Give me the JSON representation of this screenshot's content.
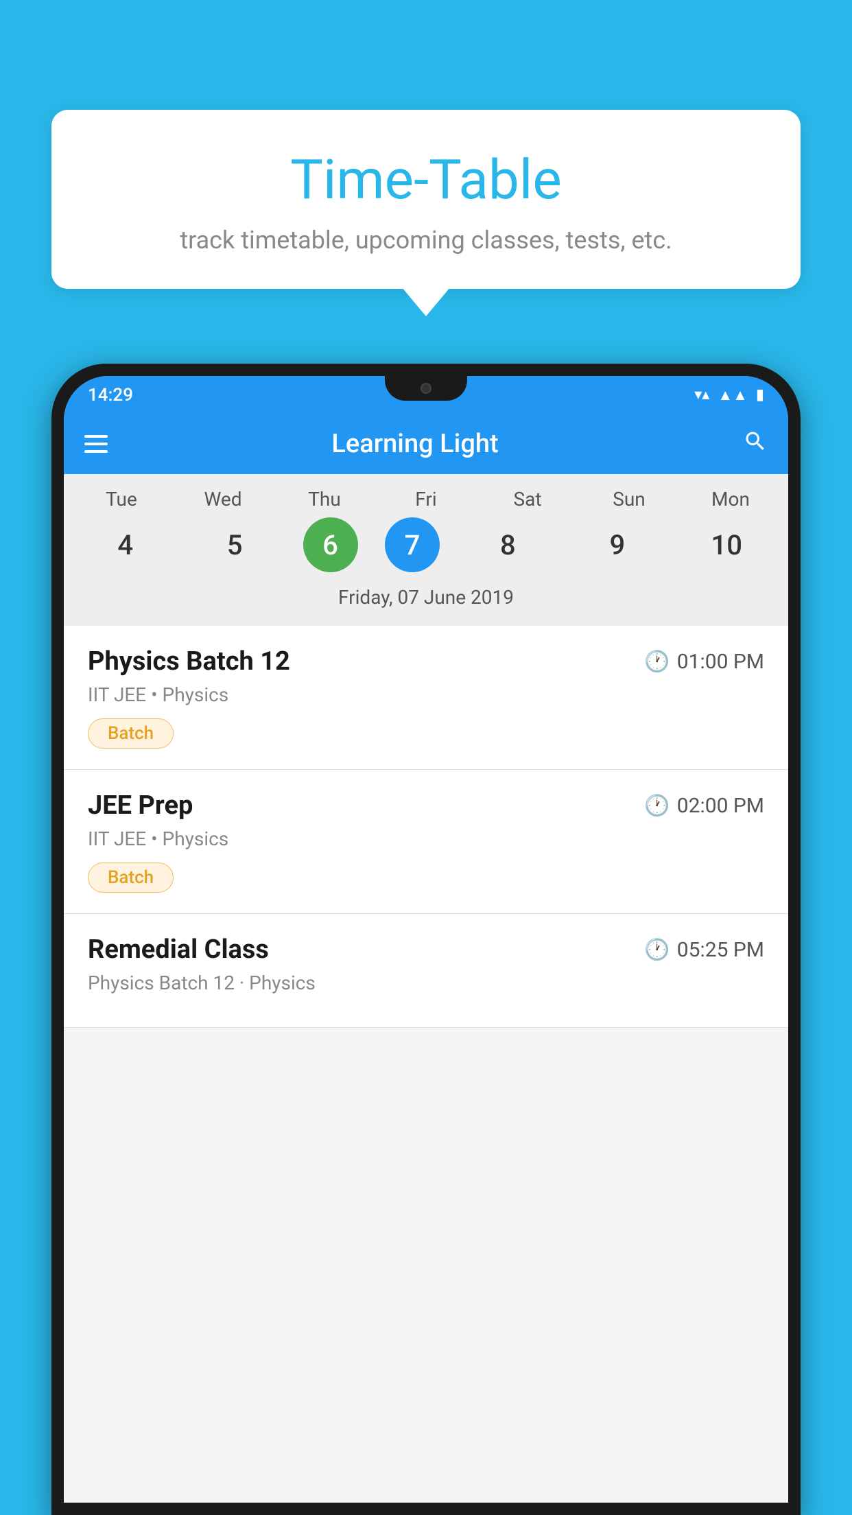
{
  "background_color": "#29b6e8",
  "speech_bubble": {
    "title": "Time-Table",
    "subtitle": "track timetable, upcoming classes, tests, etc."
  },
  "status_bar": {
    "time": "14:29",
    "icons": [
      "wifi",
      "signal",
      "battery"
    ]
  },
  "app_bar": {
    "title": "Learning Light",
    "menu_icon": "hamburger-icon",
    "search_icon": "search-icon"
  },
  "calendar": {
    "days": [
      {
        "label": "Tue",
        "number": "4"
      },
      {
        "label": "Wed",
        "number": "5"
      },
      {
        "label": "Thu",
        "number": "6",
        "state": "today"
      },
      {
        "label": "Fri",
        "number": "7",
        "state": "selected"
      },
      {
        "label": "Sat",
        "number": "8"
      },
      {
        "label": "Sun",
        "number": "9"
      },
      {
        "label": "Mon",
        "number": "10"
      }
    ],
    "selected_date": "Friday, 07 June 2019"
  },
  "schedule": [
    {
      "name": "Physics Batch 12",
      "time": "01:00 PM",
      "meta": "IIT JEE • Physics",
      "badge": "Batch"
    },
    {
      "name": "JEE Prep",
      "time": "02:00 PM",
      "meta": "IIT JEE • Physics",
      "badge": "Batch"
    },
    {
      "name": "Remedial Class",
      "time": "05:25 PM",
      "meta": "Physics Batch 12 · Physics",
      "badge": null
    }
  ],
  "labels": {
    "batch_badge": "Batch"
  }
}
